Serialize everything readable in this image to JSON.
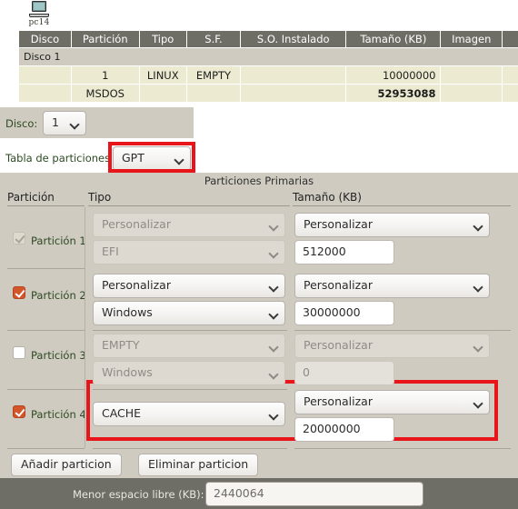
{
  "host": {
    "icon": "computer-icon",
    "label": "pc14"
  },
  "disk_table": {
    "headers": [
      "Disco",
      "Partición",
      "Tipo",
      "S.F.",
      "S.O. Instalado",
      "Tamaño (KB)",
      "Imagen",
      ""
    ],
    "group_label": "Disco 1",
    "rows": [
      {
        "disco": "",
        "particion": "1",
        "tipo": "LINUX",
        "sf": "EMPTY",
        "so": "",
        "tamano": "10000000",
        "imagen": "",
        "extra": "",
        "bold": false
      },
      {
        "disco": "",
        "particion": "MSDOS",
        "tipo": "",
        "sf": "",
        "so": "",
        "tamano": "52953088",
        "imagen": "",
        "extra": "",
        "bold": true
      }
    ]
  },
  "disk_select": {
    "label": "Disco:",
    "value": "1"
  },
  "partition_table": {
    "label": "Tabla de particiones",
    "value": "GPT",
    "highlighted": true
  },
  "primary": {
    "title": "Particiones Primarias",
    "col_particion": "Partición",
    "col_tipo": "Tipo",
    "col_tamano": "Tamaño (KB)",
    "rows": [
      {
        "label": "Partición 1",
        "checked": true,
        "checkbox_state": "checked-disabled",
        "type_preset": "Personalizar",
        "type_value": "EFI",
        "size_preset": "Personalizar",
        "size_value": "512000",
        "type_preset_disabled": true,
        "type_value_disabled": true,
        "size_preset_disabled": false,
        "size_value_disabled": false,
        "highlighted": true,
        "single_type_select": false
      },
      {
        "label": "Partición 2",
        "checked": true,
        "checkbox_state": "checked",
        "type_preset": "Personalizar",
        "type_value": "Windows",
        "size_preset": "Personalizar",
        "size_value": "30000000",
        "type_preset_disabled": false,
        "type_value_disabled": false,
        "size_preset_disabled": false,
        "size_value_disabled": false,
        "highlighted": false,
        "single_type_select": false
      },
      {
        "label": "Partición 3",
        "checked": false,
        "checkbox_state": "unchecked",
        "type_preset": "EMPTY",
        "type_value": "Windows",
        "size_preset": "Personalizar",
        "size_value": "0",
        "type_preset_disabled": true,
        "type_value_disabled": true,
        "size_preset_disabled": true,
        "size_value_disabled": true,
        "highlighted": false,
        "single_type_select": false
      },
      {
        "label": "Partición 4",
        "checked": true,
        "checkbox_state": "checked",
        "type_preset": "CACHE",
        "type_value": "",
        "size_preset": "Personalizar",
        "size_value": "20000000",
        "type_preset_disabled": false,
        "type_value_disabled": false,
        "size_preset_disabled": false,
        "size_value_disabled": false,
        "highlighted": false,
        "single_type_select": true
      }
    ]
  },
  "buttons": {
    "add": "Añadir particion",
    "remove": "Eliminar particion"
  },
  "footer": {
    "label": "Menor espacio libre (KB):",
    "value": "2440064"
  },
  "colors": {
    "panel_bg": "#cfcbc0",
    "header_bar": "#6e6e66",
    "row_bg": "#ecead1",
    "accent_checkbox": "#d4552a",
    "highlight_border": "#e8151a",
    "label_green": "#2d4a22"
  }
}
